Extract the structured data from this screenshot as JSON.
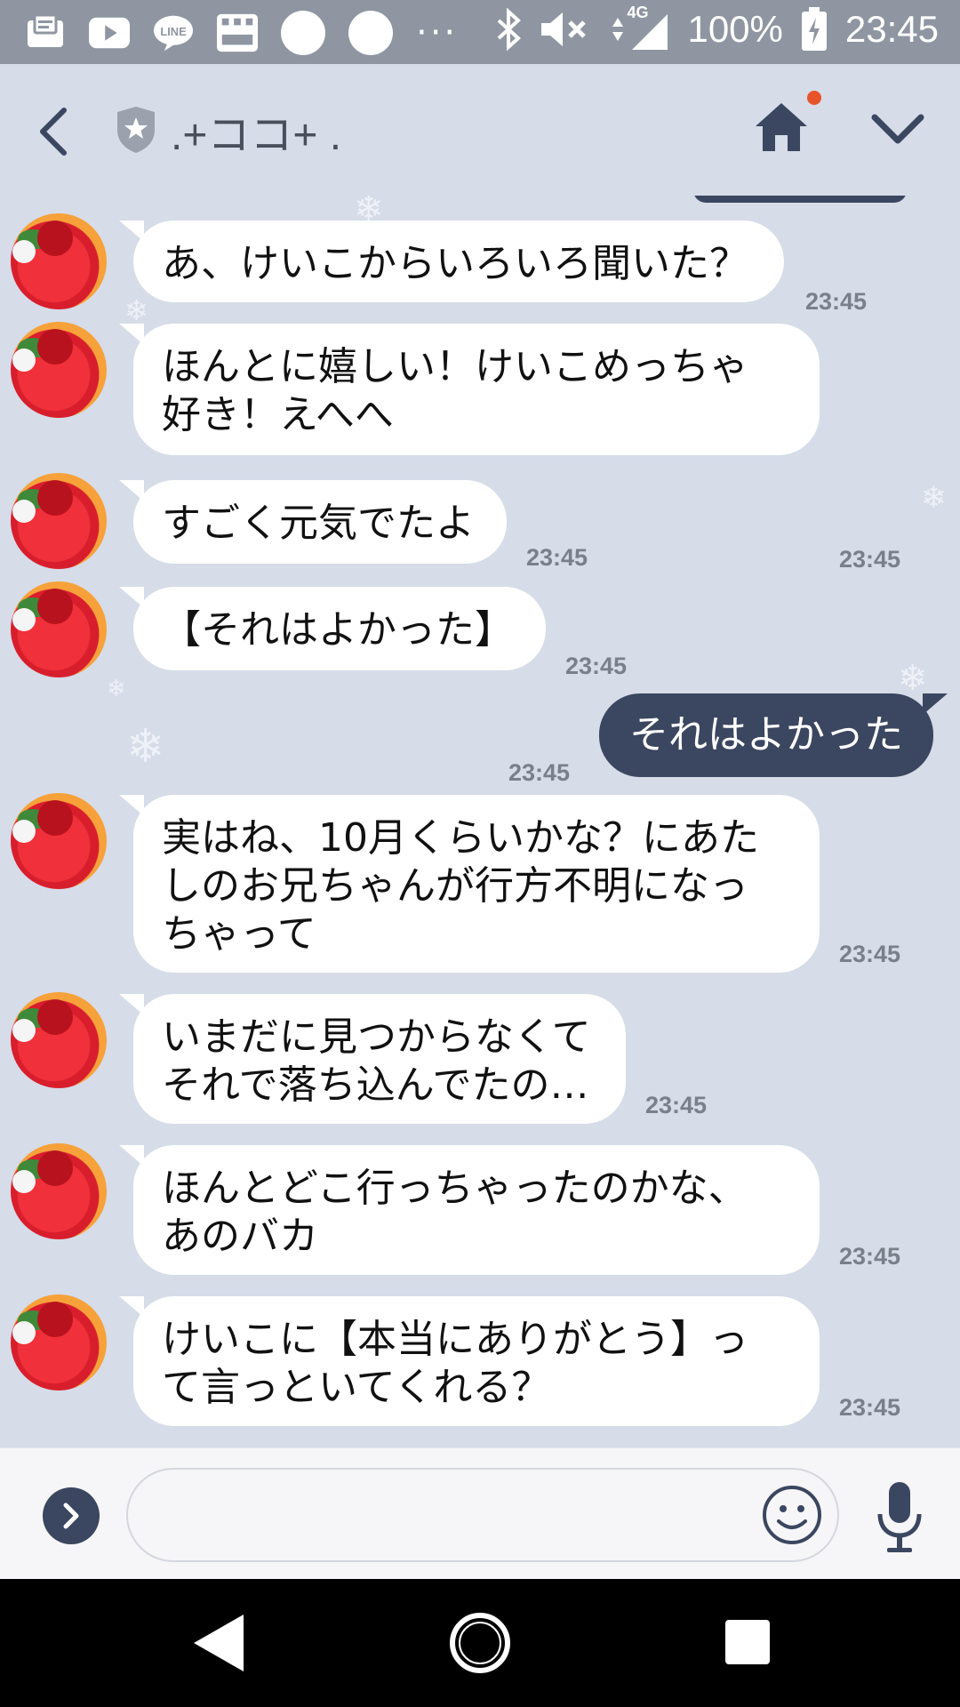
{
  "status_bar": {
    "network": "4G",
    "battery": "100%",
    "time": "23:45",
    "more": "···"
  },
  "header": {
    "title": ".+ココ+ ."
  },
  "messages": [
    {
      "direction": "in",
      "text": "あ、けいこからいろいろ聞いた？",
      "time": "23:45"
    },
    {
      "direction": "in",
      "text": "ほんとに嬉しい！けいこめっちゃ\n好き！えへへ",
      "time": "23:45"
    },
    {
      "direction": "in",
      "text": "すごく元気でたよ",
      "time": "23:45"
    },
    {
      "direction": "in",
      "text": "【それはよかった】",
      "time": "23:45"
    },
    {
      "direction": "out",
      "text": "それはよかった",
      "time": "23:45"
    },
    {
      "direction": "in",
      "text": "実はね、10月くらいかな？にあた\nしのお兄ちゃんが行方不明になっ\nちゃって",
      "time": "23:45"
    },
    {
      "direction": "in",
      "text": "いまだに見つからなくて\nそれで落ち込んでたの…",
      "time": "23:45"
    },
    {
      "direction": "in",
      "text": "ほんとどこ行っちゃったのかな、\nあのバカ",
      "time": "23:45"
    },
    {
      "direction": "in",
      "text": "けいこに【本当にありがとう】っ\nて言っといてくれる？",
      "time": "23:45"
    }
  ],
  "input": {
    "value": "",
    "placeholder": ""
  },
  "colors": {
    "background": "#d6dce8",
    "outgoing_bubble": "#3b4660",
    "incoming_bubble": "#ffffff",
    "notification_dot": "#e8542a"
  },
  "icons": [
    "mail-icon",
    "youtube-icon",
    "line-icon",
    "rakuma-icon",
    "bluetooth-icon",
    "mute-icon",
    "signal-icon",
    "battery-icon",
    "back-icon",
    "shield-icon",
    "home-icon",
    "chevron-down-icon",
    "expand-icon",
    "emoji-icon",
    "mic-icon"
  ]
}
